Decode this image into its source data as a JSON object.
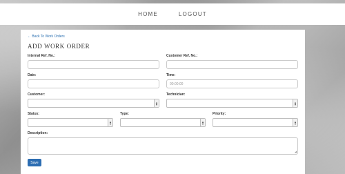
{
  "nav": {
    "home": "HOME",
    "logout": "LOGOUT"
  },
  "back_link": "← Back To Work Orders",
  "title": "ADD WORK ORDER",
  "fields": {
    "internal_ref": {
      "label": "Internal Ref. No.:",
      "value": ""
    },
    "customer_ref": {
      "label": "Customer Ref. No.:",
      "value": ""
    },
    "date": {
      "label": "Date:",
      "value": ""
    },
    "time": {
      "label": "Time:",
      "placeholder": "00:00:00"
    },
    "customer": {
      "label": "Customer:",
      "selected": ""
    },
    "technician": {
      "label": "Technician:",
      "selected": ""
    },
    "status": {
      "label": "Status:",
      "selected": ""
    },
    "type": {
      "label": "Type:",
      "selected": ""
    },
    "priority": {
      "label": "Priority:",
      "selected": ""
    },
    "description": {
      "label": "Description:",
      "value": ""
    }
  },
  "save_label": "Save"
}
